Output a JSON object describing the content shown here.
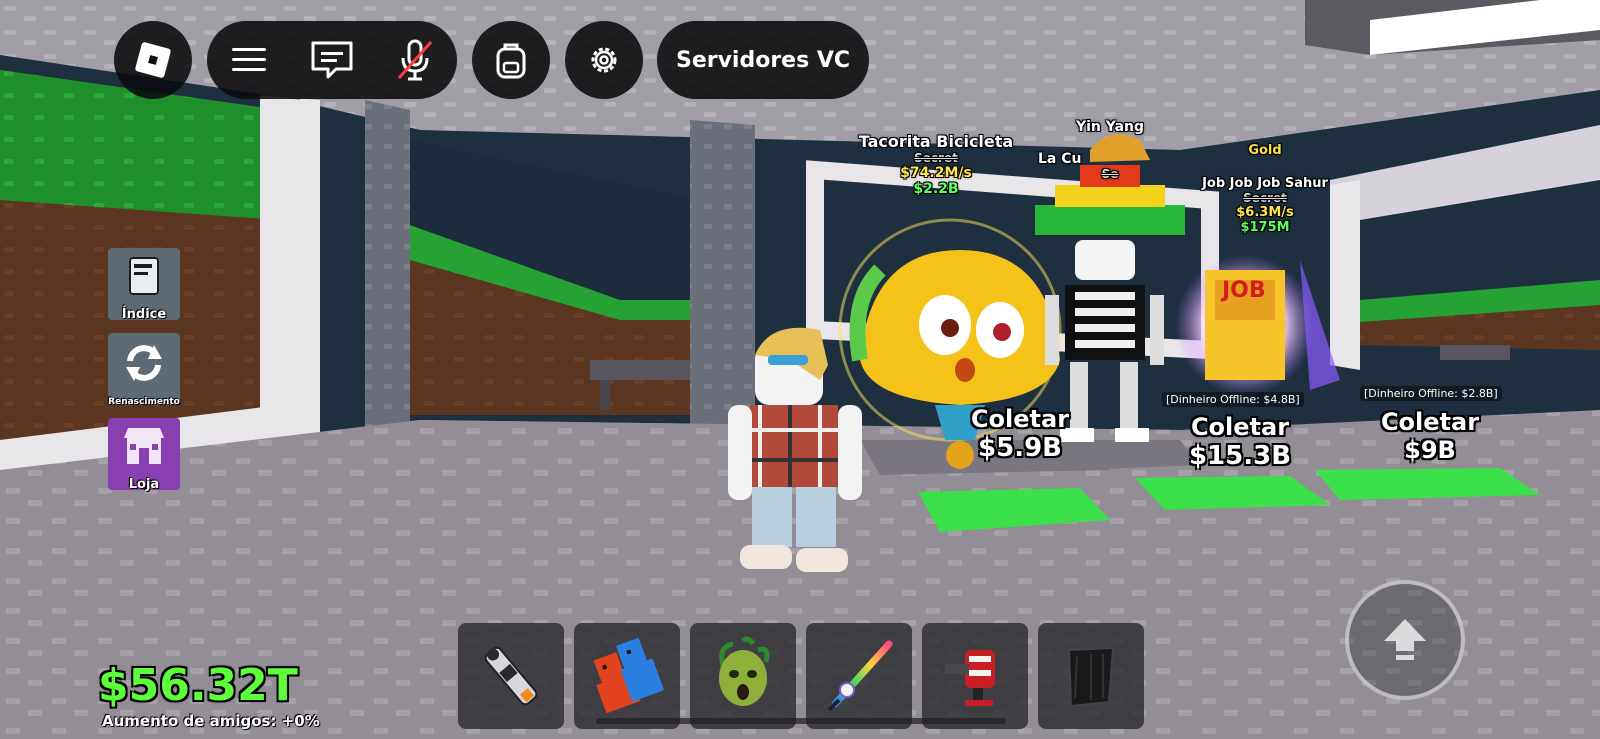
{
  "topbar": {
    "roblox_menu_icon": "roblox-logo-icon",
    "menu_icon": "hamburger-icon",
    "chat_icon": "chat-icon",
    "mic_icon": "mic-muted-icon",
    "backpack_icon": "backpack-icon",
    "settings_icon": "gear-icon",
    "servers_label": "Servidores VC"
  },
  "side_menu": [
    {
      "label": "Índice",
      "icon": "book-icon",
      "color": "#5e6a74"
    },
    {
      "label": "Renascimento",
      "icon": "rebirth-icon",
      "color": "#5e6a74"
    },
    {
      "label": "Loja",
      "icon": "shop-icon",
      "color": "#8a3fb0"
    }
  ],
  "pets": [
    {
      "name": "Tacorita Bicicleta",
      "rarity": "Secret",
      "rate": "$74.2M/s",
      "price": "$2.2B"
    },
    {
      "name": "Yin Yang",
      "sub": "La Cu",
      "rarity": "Se"
    },
    {
      "mutation": "Gold",
      "name": "Job Job Job Sahur",
      "rarity": "Secret",
      "rate": "$6.3M/s",
      "price": "$175M"
    }
  ],
  "collectors": [
    {
      "label": "Coletar",
      "amount": "$5.9B"
    },
    {
      "label": "Coletar",
      "amount": "$15.3B",
      "offline": "[Dinheiro Offline: $4.8B]"
    },
    {
      "label": "Coletar",
      "amount": "$9B",
      "offline": "[Dinheiro Offline: $2.8B]"
    }
  ],
  "sign_text": "JOB",
  "hotbar": [
    {
      "icon": "portal-gun-icon"
    },
    {
      "icon": "blocky-figure-icon"
    },
    {
      "icon": "medusa-head-icon"
    },
    {
      "icon": "rainbow-sword-icon"
    },
    {
      "icon": "laser-blaster-icon"
    },
    {
      "icon": "dark-cloak-icon"
    }
  ],
  "hud": {
    "money": "$56.32T",
    "friend_boost": "Aumento de amigos: +0%",
    "jump_icon": "jump-arrow-icon"
  }
}
